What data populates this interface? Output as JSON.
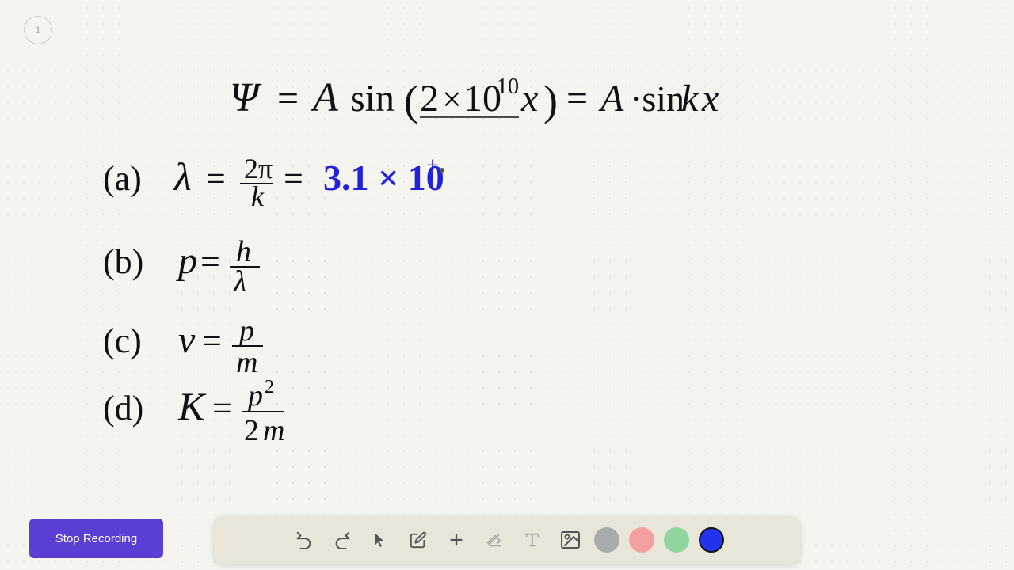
{
  "page": {
    "number": "1",
    "background": "#f5f4ee"
  },
  "toolbar": {
    "undo_label": "↺",
    "redo_label": "↻",
    "select_label": "▲",
    "pen_label": "✏",
    "add_label": "+",
    "eraser_label": "/",
    "text_label": "A",
    "image_label": "▦",
    "colors": [
      "#aaaaaa",
      "#f4a0a0",
      "#90d4a0",
      "#3333ee"
    ],
    "active_color_index": 3
  },
  "stop_recording": {
    "label": "Stop Recording"
  },
  "equations": {
    "main": "Ψ = A sin(2×10¹⁰x) = A·sin kx",
    "a": "(a)  λ = 2π/k = 3.1 × 10⁺",
    "b": "(b)  p = h/λ",
    "c": "(c)  v = p/m",
    "d": "(d)  K = p²/2m"
  }
}
